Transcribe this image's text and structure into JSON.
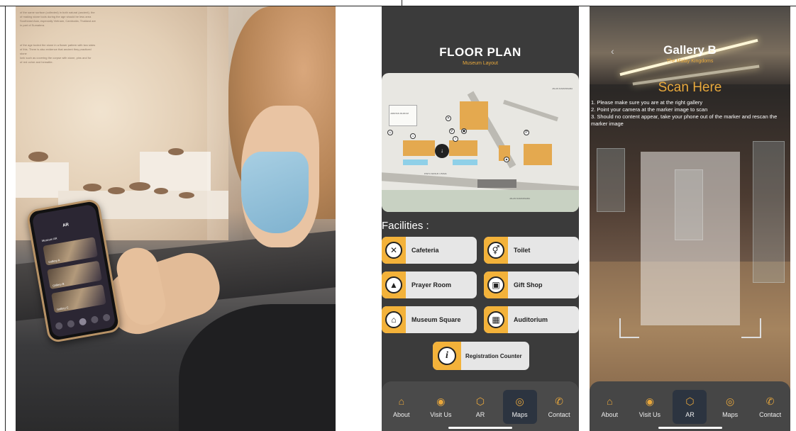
{
  "photo": {
    "wall_text_1": "of the same surface (collected) in both natural (ancient). the\nof making stone tools during the age should be less area\nSoutheast Asia, especially Vietnam, Cambodia, Thailand are\nin part of Sumatera.",
    "wall_text_2": "of the age tooled the stone in a flower pattern with two sides\nof this. There is also evidence that ancient they practiced stone\nlonk such as covering the corpse with stone, pins and for\nof red ochre and hematite.",
    "phone_title": "AR",
    "phone_subtitle": "Museum AR",
    "phone_card_1": "Gallery A",
    "phone_card_2": "Gallery B",
    "phone_card_3": "Gallery C"
  },
  "floorplan": {
    "title": "FLOOR PLAN",
    "subtitle": "Museum Layout",
    "facilities_title": "Facilities :",
    "facilities": [
      {
        "label": "Cafeteria",
        "icon": "✕"
      },
      {
        "label": "Toilet",
        "icon": "⚥"
      },
      {
        "label": "Prayer Room",
        "icon": "▲"
      },
      {
        "label": "Gift Shop",
        "icon": "▣"
      },
      {
        "label": "Museum Square",
        "icon": "⌂"
      },
      {
        "label": "Auditorium",
        "icon": "▦"
      }
    ],
    "registration": {
      "label": "Registration Counter",
      "icon": "i"
    },
    "nav": [
      {
        "label": "About",
        "icon": "⌂",
        "active": false
      },
      {
        "label": "Visit Us",
        "icon": "◉",
        "active": false
      },
      {
        "label": "AR",
        "icon": "⬡",
        "active": false
      },
      {
        "label": "Maps",
        "icon": "◎",
        "active": true
      },
      {
        "label": "Contact",
        "icon": "✆",
        "active": false
      }
    ]
  },
  "ar": {
    "title": "Gallery B",
    "subtitle": "The Malay Kingdoms",
    "scan_title": "Scan Here",
    "instructions": [
      "1. Please make sure you are at the right gallery",
      "2. Point your camera at the marker image to scan",
      "3. Should no content appear, take your phone out of the marker and rescan the marker image"
    ],
    "nav": [
      {
        "label": "About",
        "icon": "⌂",
        "active": false
      },
      {
        "label": "Visit Us",
        "icon": "◉",
        "active": false
      },
      {
        "label": "AR",
        "icon": "⬡",
        "active": true
      },
      {
        "label": "Maps",
        "icon": "◎",
        "active": false
      },
      {
        "label": "Contact",
        "icon": "✆",
        "active": false
      }
    ]
  }
}
